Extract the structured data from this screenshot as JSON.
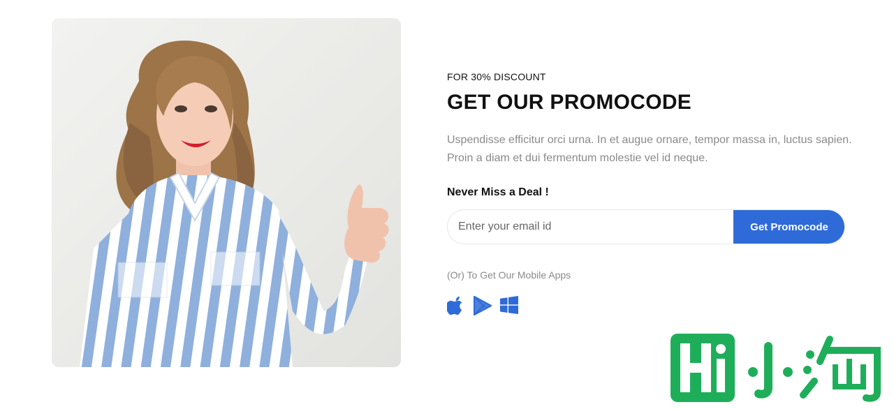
{
  "promo": {
    "eyebrow": "FOR 30% DISCOUNT",
    "title": "GET OUR PROMOCODE",
    "description": "Uspendisse efficitur orci urna. In et augue ornare, tempor massa in, luctus sapien. Proin a diam et dui fermentum molestie vel id neque.",
    "deal_heading": "Never Miss a Deal !",
    "email_placeholder": "Enter your email id",
    "button_label": "Get Promocode",
    "apps_note": "(Or) To Get Our Mobile Apps"
  },
  "apps": [
    {
      "icon": "apple-icon"
    },
    {
      "icon": "google-play-icon"
    },
    {
      "icon": "windows-icon"
    }
  ],
  "watermark": {
    "text": "Hi 小淘"
  },
  "colors": {
    "accent": "#2f6bd8",
    "watermark_green": "#1eae5a",
    "muted_text": "#8a8a8a"
  }
}
